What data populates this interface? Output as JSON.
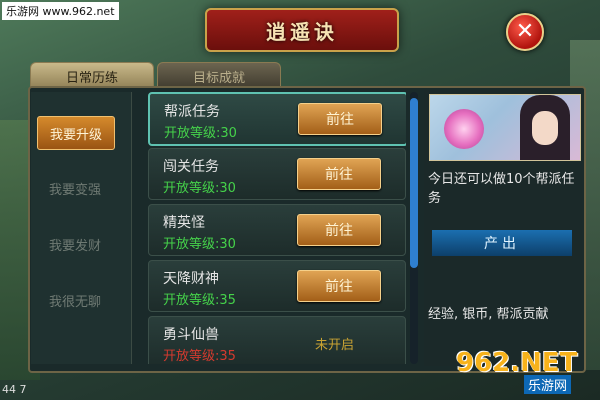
{
  "watermark": {
    "site": "乐游网 www.962.net",
    "corner_text": "44 7"
  },
  "header": {
    "title": "逍遥诀"
  },
  "tabs": [
    {
      "label": "日常历练",
      "active": true
    },
    {
      "label": "目标成就",
      "active": false
    }
  ],
  "sidebar": {
    "items": [
      {
        "label": "我要升级",
        "active": true
      },
      {
        "label": "我要变强",
        "active": false
      },
      {
        "label": "我要发财",
        "active": false
      },
      {
        "label": "我很无聊",
        "active": false
      }
    ]
  },
  "tasks": [
    {
      "name": "帮派任务",
      "level": "开放等级:30",
      "action": "前往",
      "locked": false
    },
    {
      "name": "闯关任务",
      "level": "开放等级:30",
      "action": "前往",
      "locked": false
    },
    {
      "name": "精英怪",
      "level": "开放等级:30",
      "action": "前往",
      "locked": false
    },
    {
      "name": "天降财神",
      "level": "开放等级:35",
      "action": "前往",
      "locked": false
    },
    {
      "name": "勇斗仙兽",
      "level": "开放等级:35",
      "action": "未开启",
      "locked": true
    }
  ],
  "detail": {
    "description": "今日还可以做10个帮派任务",
    "output_header": "产出",
    "rewards": "经验, 银币, 帮派贡献"
  },
  "logo": {
    "main": "962.NET",
    "sub": "乐游网"
  },
  "colors": {
    "accent_orange": "#d58a2c",
    "level_green": "#45d24a",
    "level_red": "#d43a2f",
    "banner_red": "#a0201a",
    "output_blue": "#1b6fb0"
  }
}
